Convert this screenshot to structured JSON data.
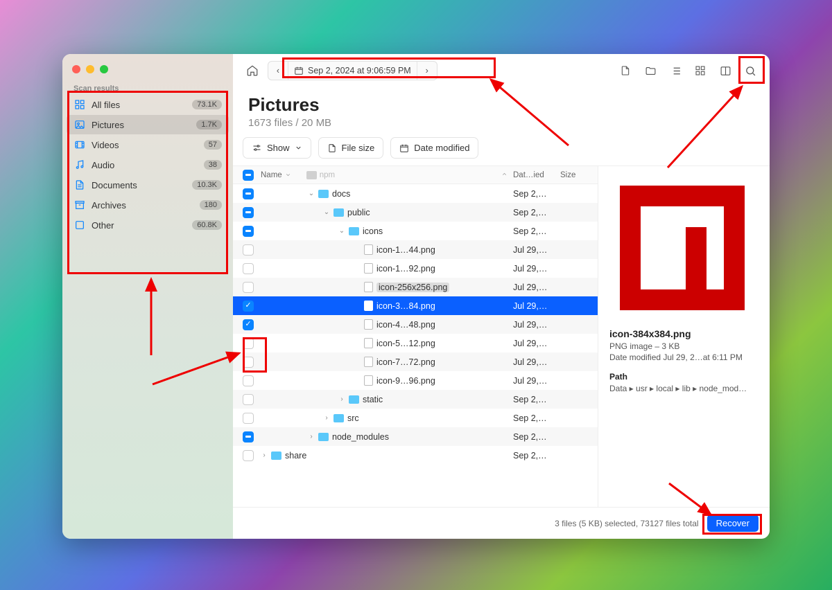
{
  "sidebar": {
    "heading": "Scan results",
    "items": [
      {
        "icon": "grid",
        "label": "All files",
        "badge": "73.1K",
        "sel": false
      },
      {
        "icon": "image",
        "label": "Pictures",
        "badge": "1.7K",
        "sel": true
      },
      {
        "icon": "video",
        "label": "Videos",
        "badge": "57",
        "sel": false
      },
      {
        "icon": "music",
        "label": "Audio",
        "badge": "38",
        "sel": false
      },
      {
        "icon": "doc",
        "label": "Documents",
        "badge": "10.3K",
        "sel": false
      },
      {
        "icon": "archive",
        "label": "Archives",
        "badge": "180",
        "sel": false
      },
      {
        "icon": "other",
        "label": "Other",
        "badge": "60.8K",
        "sel": false
      }
    ]
  },
  "toolbar": {
    "timestamp": "Sep 2, 2024 at 9:06:59 PM"
  },
  "header": {
    "title": "Pictures",
    "subtitle": "1673 files / 20 MB"
  },
  "filters": {
    "show": "Show",
    "size": "File size",
    "date": "Date modified"
  },
  "cols": {
    "name": "Name",
    "date": "Dat…ied",
    "size": "Size",
    "npm": "npm"
  },
  "rows": [
    {
      "cb": "partial",
      "ind": 1,
      "chev": "d",
      "type": "folder",
      "name": "docs",
      "date": "Sep 2,…"
    },
    {
      "cb": "partial",
      "ind": 2,
      "chev": "d",
      "type": "folder",
      "name": "public",
      "date": "Sep 2,…"
    },
    {
      "cb": "partial",
      "ind": 3,
      "chev": "d",
      "type": "folder",
      "name": "icons",
      "date": "Sep 2,…"
    },
    {
      "cb": "",
      "ind": 4,
      "type": "img",
      "name": "icon-1…44.png",
      "date": "Jul 29,…"
    },
    {
      "cb": "",
      "ind": 4,
      "type": "img",
      "name": "icon-1…92.png",
      "date": "Jul 29,…"
    },
    {
      "cb": "",
      "ind": 4,
      "type": "img",
      "name": "icon-256x256.png",
      "date": "Jul 29,…",
      "hl": true
    },
    {
      "cb": "checked",
      "ind": 4,
      "type": "img",
      "name": "icon-3…84.png",
      "date": "Jul 29,…",
      "sel": true
    },
    {
      "cb": "checked",
      "ind": 4,
      "type": "img",
      "name": "icon-4…48.png",
      "date": "Jul 29,…"
    },
    {
      "cb": "",
      "ind": 4,
      "type": "img",
      "name": "icon-5…12.png",
      "date": "Jul 29,…"
    },
    {
      "cb": "",
      "ind": 4,
      "type": "img",
      "name": "icon-7…72.png",
      "date": "Jul 29,…"
    },
    {
      "cb": "",
      "ind": 4,
      "type": "img",
      "name": "icon-9…96.png",
      "date": "Jul 29,…"
    },
    {
      "cb": "",
      "ind": 3,
      "chev": "r",
      "type": "folder",
      "name": "static",
      "date": "Sep 2,…"
    },
    {
      "cb": "",
      "ind": 2,
      "chev": "r",
      "type": "folder",
      "name": "src",
      "date": "Sep 2,…"
    },
    {
      "cb": "partial",
      "ind": 1,
      "chev": "r",
      "type": "folder",
      "name": "node_modules",
      "date": "Sep 2,…"
    },
    {
      "cb": "",
      "ind": 0,
      "chev": "r",
      "type": "folder",
      "name": "share",
      "date": "Sep 2,…"
    }
  ],
  "preview": {
    "name": "icon-384x384.png",
    "kind": "PNG image – 3 KB",
    "modified": "Date modified  Jul 29, 2…at 6:11 PM",
    "path_h": "Path",
    "path": "Data ▸ usr ▸ local ▸ lib ▸ node_mod…"
  },
  "footer": {
    "status": "3 files (5 KB) selected, 73127 files total",
    "recover": "Recover"
  }
}
